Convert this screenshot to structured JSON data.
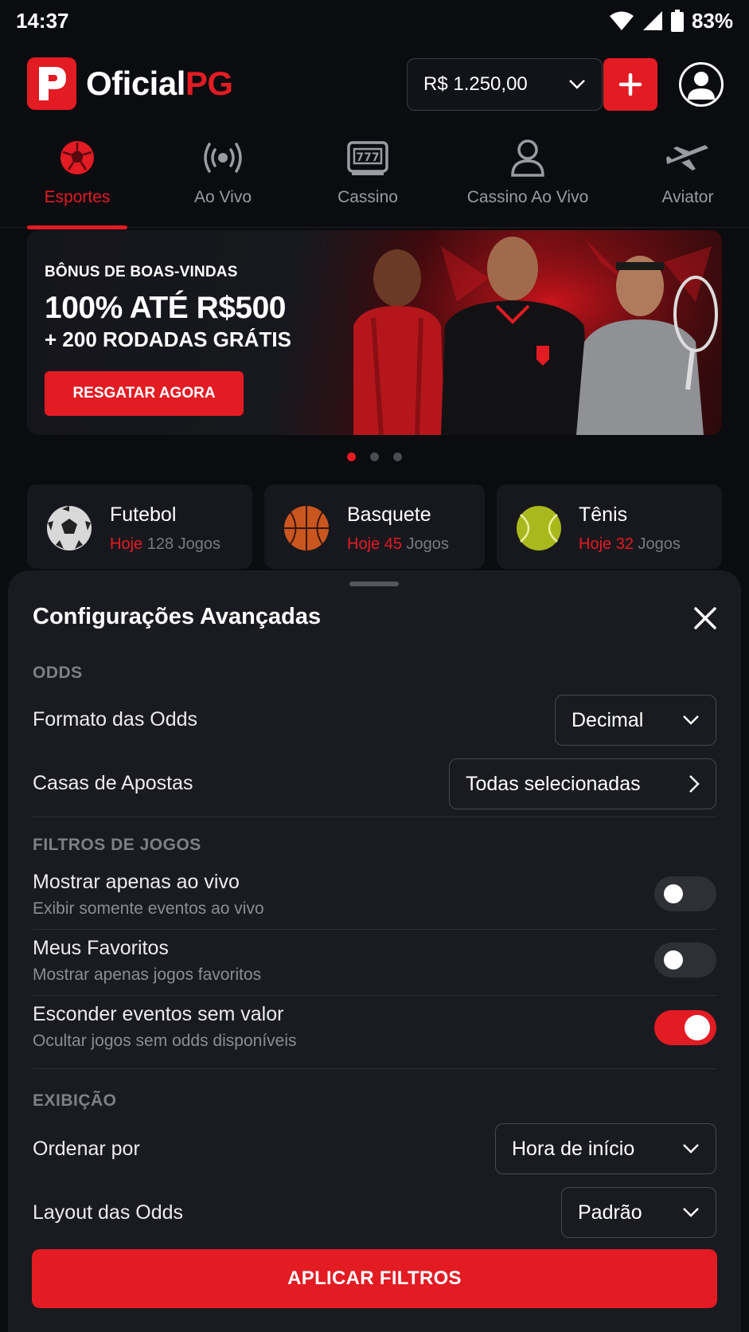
{
  "status_bar": {
    "time": "14:37",
    "battery": "83%"
  },
  "header": {
    "logo_main": "Oficial",
    "logo_accent": "PG",
    "balance": "R$ 1.250,00"
  },
  "categories": [
    {
      "label": "Esportes",
      "icon": "soccer-ball-icon",
      "active": true
    },
    {
      "label": "Ao Vivo",
      "icon": "broadcast-icon"
    },
    {
      "label": "Cassino",
      "icon": "slot-machine-icon"
    },
    {
      "label": "Cassino Ao Vivo",
      "icon": "dealer-icon"
    },
    {
      "label": "Aviator",
      "icon": "airplane-icon"
    }
  ],
  "banner": {
    "kicker": "BÔNUS DE BOAS-VINDAS",
    "headline": "100% ATÉ R$500",
    "subline": "+ 200 RODADAS GRÁTIS",
    "cta": "RESGATAR AGORA"
  },
  "sports": [
    {
      "name": "Futebol",
      "today": "Hoje",
      "count": "128 Jogos"
    },
    {
      "name": "Basquete",
      "today": "Hoje 45",
      "count": "Jogos"
    },
    {
      "name": "Tênis",
      "today": "Hoje 32",
      "count": "Jogos"
    }
  ],
  "sheet": {
    "title": "Configurações Avançadas",
    "odds_section": "ODDS",
    "odds_format_label": "Formato das Odds",
    "odds_format_value": "Decimal",
    "bookmakers_label": "Casas de Apostas",
    "bookmakers_value": "Todas selecionadas",
    "filters_section": "FILTROS DE JOGOS",
    "live_only_label": "Mostrar apenas ao vivo",
    "live_only_sub": "Exibir somente eventos ao vivo",
    "live_only_on": false,
    "favorites_label": "Meus Favoritos",
    "favorites_sub": "Mostrar apenas jogos favoritos",
    "favorites_on": false,
    "hide_no_value_label": "Esconder eventos sem valor",
    "hide_no_value_sub": "Ocultar jogos sem odds disponíveis",
    "hide_no_value_on": true,
    "display_section": "EXIBIÇÃO",
    "sort_label": "Ordenar por",
    "sort_value": "Hora de início",
    "layout_label": "Layout das Odds",
    "layout_value": "Padrão",
    "apply": "APLICAR FILTROS"
  },
  "colors": {
    "accent": "#e31b23",
    "background": "#0b0c10",
    "sheet": "#1a1b20"
  }
}
